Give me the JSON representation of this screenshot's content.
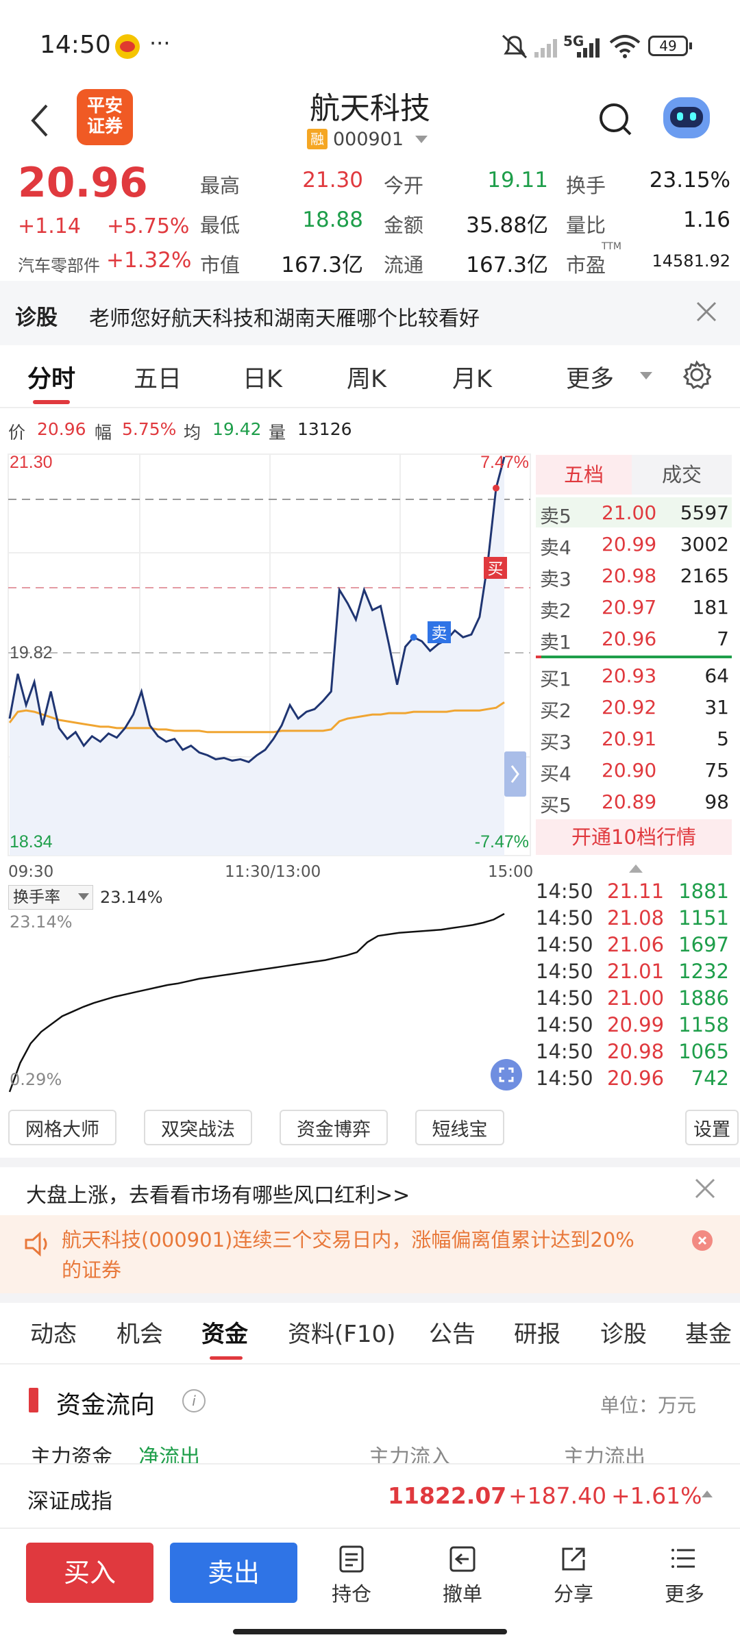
{
  "status_bar": {
    "time": "14:50",
    "dots": "···",
    "network": "5G",
    "battery": "49"
  },
  "header": {
    "logo": "平安\n证券",
    "logo_line1": "平安",
    "logo_line2": "证券",
    "stock_name": "航天科技",
    "margin_badge": "融",
    "stock_code": "000901"
  },
  "quote": {
    "price": "20.96",
    "change": "+1.14",
    "change_pct": "+5.75%",
    "sector_label": "汽车零部件",
    "sector_pct": "+1.32%",
    "rows": [
      [
        {
          "label": "最高",
          "value": "21.30",
          "color": "red"
        },
        {
          "label": "今开",
          "value": "19.11",
          "color": "green"
        },
        {
          "label": "换手",
          "value": "23.15%",
          "color": "black"
        }
      ],
      [
        {
          "label": "最低",
          "value": "18.88",
          "color": "green"
        },
        {
          "label": "金额",
          "value": "35.88亿",
          "color": "black"
        },
        {
          "label": "量比",
          "value": "1.16",
          "color": "black"
        }
      ],
      [
        {
          "label": "市值",
          "value": "167.3亿",
          "color": "black"
        },
        {
          "label": "流通",
          "value": "167.3亿",
          "color": "black"
        },
        {
          "label": "市盈",
          "value": "14581.92",
          "color": "black",
          "sup": "TTM"
        }
      ]
    ]
  },
  "diagnose": {
    "label": "诊股",
    "text": "老师您好航天科技和湖南天雁哪个比较看好"
  },
  "chart_tabs": [
    "分时",
    "五日",
    "日K",
    "周K",
    "月K",
    "更多"
  ],
  "info_bar": {
    "price_label": "价",
    "price": "20.96",
    "range_label": "幅",
    "range": "5.75%",
    "avg_label": "均",
    "avg": "19.42",
    "vol_label": "量",
    "vol": "13126"
  },
  "chart_labels": {
    "top_left": "21.30",
    "top_right": "7.47%",
    "mid": "19.82",
    "bottom_left": "18.34",
    "bottom_right": "-7.47%",
    "t_start": "09:30",
    "t_mid": "11:30/13:00",
    "t_end": "15:00",
    "buy_tag": "买",
    "sell_tag": "卖"
  },
  "chart_data": [
    {
      "type": "line",
      "title": "分时",
      "ylim": [
        18.34,
        21.3
      ],
      "x_range": [
        "09:30",
        "15:00"
      ],
      "reference_price": 19.82,
      "series": [
        {
          "name": "价",
          "values": [
            19.35,
            19.68,
            19.45,
            19.62,
            19.3,
            19.55,
            19.28,
            19.2,
            19.25,
            19.15,
            19.22,
            19.18,
            19.24,
            19.21,
            19.28,
            19.38,
            19.55,
            19.3,
            19.22,
            19.18,
            19.2,
            19.12,
            19.15,
            19.1,
            19.08,
            19.05,
            19.06,
            19.04,
            19.05,
            19.03,
            19.08,
            19.12,
            19.2,
            19.3,
            19.45,
            19.35,
            19.4,
            19.42,
            19.48,
            19.55,
            20.3,
            20.2,
            20.08,
            20.3,
            20.15,
            20.18,
            19.9,
            19.6,
            19.88,
            19.95,
            19.92,
            19.85,
            19.9,
            19.93,
            20.0,
            19.95,
            19.97,
            20.1,
            20.5,
            21.05,
            21.28
          ]
        },
        {
          "name": "均",
          "values": [
            19.32,
            19.4,
            19.41,
            19.4,
            19.38,
            19.36,
            19.34,
            19.33,
            19.32,
            19.31,
            19.3,
            19.29,
            19.29,
            19.28,
            19.28,
            19.28,
            19.28,
            19.28,
            19.27,
            19.27,
            19.26,
            19.26,
            19.26,
            19.26,
            19.25,
            19.25,
            19.25,
            19.25,
            19.25,
            19.25,
            19.25,
            19.25,
            19.25,
            19.26,
            19.26,
            19.26,
            19.26,
            19.26,
            19.26,
            19.27,
            19.33,
            19.35,
            19.36,
            19.37,
            19.38,
            19.38,
            19.39,
            19.39,
            19.39,
            19.4,
            19.4,
            19.4,
            19.4,
            19.4,
            19.41,
            19.41,
            19.41,
            19.41,
            19.42,
            19.43,
            19.47
          ]
        }
      ]
    },
    {
      "type": "line",
      "title": "换手率",
      "ylim": [
        0.29,
        23.14
      ],
      "series": [
        {
          "name": "换手率",
          "values": [
            0.29,
            4.0,
            6.5,
            8.0,
            9.0,
            10.0,
            10.6,
            11.2,
            11.7,
            12.1,
            12.5,
            12.8,
            13.1,
            13.4,
            13.7,
            14.0,
            14.2,
            14.5,
            14.8,
            15.0,
            15.2,
            15.4,
            15.6,
            15.8,
            16.0,
            16.2,
            16.4,
            16.6,
            16.8,
            17.0,
            17.2,
            17.5,
            17.8,
            18.2,
            19.5,
            20.3,
            20.5,
            20.7,
            20.8,
            20.9,
            21.0,
            21.1,
            21.3,
            21.5,
            21.7,
            22.0,
            22.4,
            23.14
          ]
        }
      ]
    }
  ],
  "order_book": {
    "tab_five": "五档",
    "tab_deal": "成交",
    "sells": [
      {
        "label": "卖5",
        "price": "21.00",
        "vol": "5597"
      },
      {
        "label": "卖4",
        "price": "20.99",
        "vol": "3002"
      },
      {
        "label": "卖3",
        "price": "20.98",
        "vol": "2165"
      },
      {
        "label": "卖2",
        "price": "20.97",
        "vol": "181"
      },
      {
        "label": "卖1",
        "price": "20.96",
        "vol": "7"
      }
    ],
    "buys": [
      {
        "label": "买1",
        "price": "20.93",
        "vol": "64"
      },
      {
        "label": "买2",
        "price": "20.92",
        "vol": "31"
      },
      {
        "label": "买3",
        "price": "20.91",
        "vol": "5"
      },
      {
        "label": "买4",
        "price": "20.90",
        "vol": "75"
      },
      {
        "label": "买5",
        "price": "20.89",
        "vol": "98"
      }
    ],
    "open_ten": "开通10档行情"
  },
  "turnover": {
    "selector": "换手率",
    "value": "23.14%",
    "max_label": "23.14%",
    "min_label": "0.29%"
  },
  "trades": [
    {
      "time": "14:50",
      "price": "21.11",
      "vol": "1881"
    },
    {
      "time": "14:50",
      "price": "21.08",
      "vol": "1151"
    },
    {
      "time": "14:50",
      "price": "21.06",
      "vol": "1697"
    },
    {
      "time": "14:50",
      "price": "21.01",
      "vol": "1232"
    },
    {
      "time": "14:50",
      "price": "21.00",
      "vol": "1886"
    },
    {
      "time": "14:50",
      "price": "20.99",
      "vol": "1158"
    },
    {
      "time": "14:50",
      "price": "20.98",
      "vol": "1065"
    },
    {
      "time": "14:50",
      "price": "20.96",
      "vol": "742"
    }
  ],
  "tools": [
    "网格大师",
    "双突战法",
    "资金博弈",
    "短线宝"
  ],
  "settings": "设置",
  "promo": "大盘上涨，去看看市场有哪些风口红利>>",
  "alert": "航天科技(000901)连续三个交易日内，涨幅偏离值累计达到20%的证券",
  "alert_line1": "航天科技(000901)连续三个交易日内，涨幅偏离值累计达到20%",
  "alert_line2": "的证券",
  "bottom_tabs": [
    "动态",
    "机会",
    "资金",
    "资料(F10)",
    "公告",
    "研报",
    "诊股",
    "基金"
  ],
  "fund_flow": {
    "title": "资金流向",
    "unit": "单位：万元",
    "peek_left": "主力资金",
    "peek_left_value": "净流出",
    "peek_mid": "主力流入",
    "peek_right": "主力流出"
  },
  "index_bar": {
    "name": "深证成指",
    "value": "11822.07",
    "change": "+187.40",
    "pct": "+1.61%"
  },
  "actions": {
    "buy": "买入",
    "sell": "卖出",
    "position": "持仓",
    "cancel": "撤单",
    "share": "分享",
    "more": "更多"
  },
  "colors": {
    "red": "#e0393e",
    "green": "#1e9e4a",
    "blue": "#2f74e6",
    "price_line": "#1f3572",
    "avg_line": "#f0a531"
  }
}
